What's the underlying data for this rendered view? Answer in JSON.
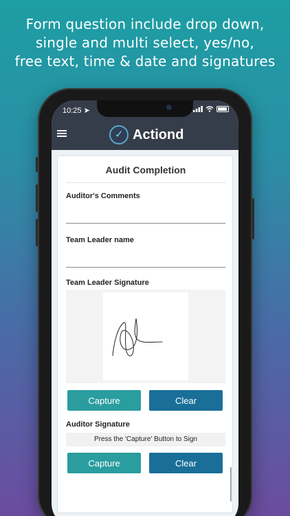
{
  "promo": {
    "line1": "Form question include drop down,",
    "line2": "single and multi select, yes/no,",
    "line3": "free text, time & date and signatures"
  },
  "status_bar": {
    "time": "10:25",
    "location_icon": "location-arrow-icon",
    "signal_icon": "cellular-signal-icon",
    "wifi_icon": "wifi-icon",
    "battery_icon": "battery-icon"
  },
  "app_bar": {
    "menu_icon": "hamburger-menu-icon",
    "brand_name": "Actiond",
    "background": "#363d4a"
  },
  "form": {
    "title": "Audit Completion",
    "auditor_comments": {
      "label": "Auditor's Comments",
      "value": ""
    },
    "team_leader_name": {
      "label": "Team Leader name",
      "value": ""
    },
    "team_leader_signature": {
      "label": "Team Leader Signature",
      "capture_label": "Capture",
      "clear_label": "Clear"
    },
    "auditor_signature": {
      "label": "Auditor Signature",
      "instruction": "Press the 'Capture' Button to Sign",
      "capture_label": "Capture",
      "clear_label": "Clear"
    }
  },
  "colors": {
    "capture_button": "#2a9d9f",
    "clear_button": "#1a6f98"
  }
}
